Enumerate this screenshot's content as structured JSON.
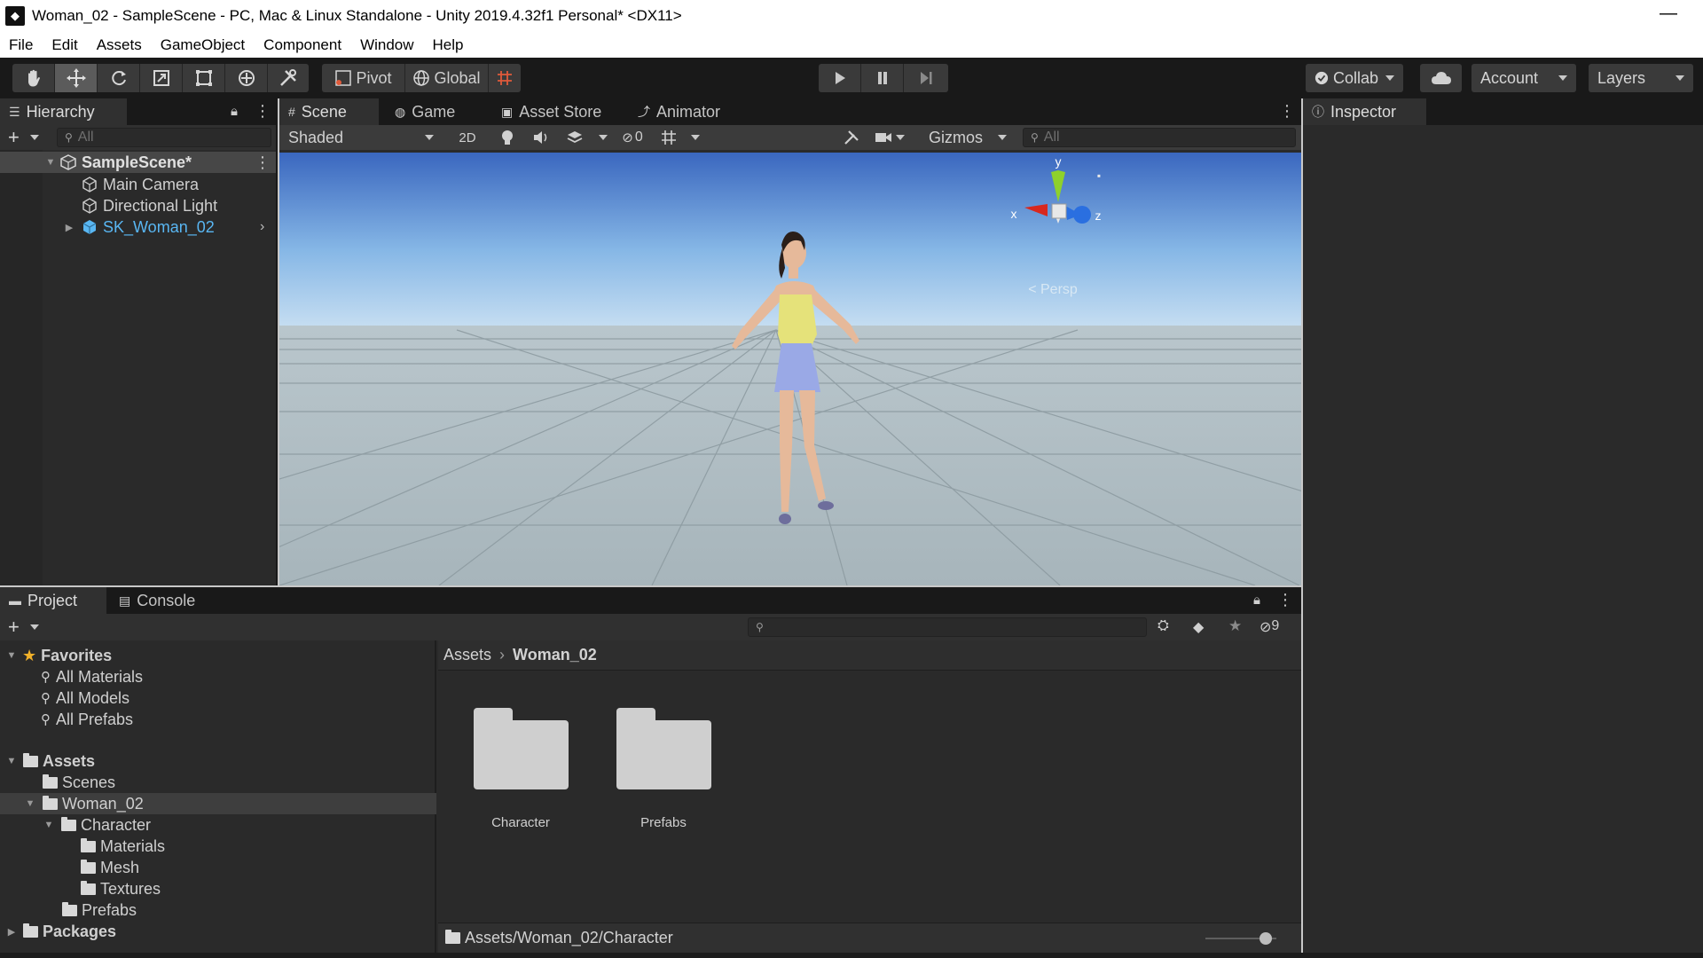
{
  "window": {
    "title": "Woman_02 - SampleScene - PC, Mac & Linux Standalone - Unity 2019.4.32f1 Personal* <DX11>",
    "minimize_glyph": "—"
  },
  "menu": [
    "File",
    "Edit",
    "Assets",
    "GameObject",
    "Component",
    "Window",
    "Help"
  ],
  "toolbar": {
    "pivot_label": "Pivot",
    "global_label": "Global",
    "collab_label": "Collab",
    "account_label": "Account",
    "layers_label": "Layers"
  },
  "hierarchy": {
    "tab_label": "Hierarchy",
    "search_placeholder": "All",
    "scene_name": "SampleScene*",
    "items": [
      "Main Camera",
      "Directional Light",
      "SK_Woman_02"
    ]
  },
  "scene_tabs": [
    "Scene",
    "Game",
    "Asset Store",
    "Animator"
  ],
  "scene_toolbar": {
    "shading_mode": "Shaded",
    "mode_2d": "2D",
    "hidden_count": "0",
    "gizmos_label": "Gizmos",
    "search_placeholder": "All"
  },
  "gizmo": {
    "y": "y",
    "x": "x",
    "z": "z",
    "persp_label": "< Persp"
  },
  "inspector": {
    "tab_label": "Inspector"
  },
  "project": {
    "tabs": [
      "Project",
      "Console"
    ],
    "hidden_count": "9",
    "breadcrumb": [
      "Assets",
      "Woman_02"
    ],
    "tree": {
      "favorites_label": "Favorites",
      "favorites": [
        "All Materials",
        "All Models",
        "All Prefabs"
      ],
      "assets_label": "Assets",
      "scenes": "Scenes",
      "woman": "Woman_02",
      "character": "Character",
      "materials": "Materials",
      "mesh": "Mesh",
      "textures": "Textures",
      "prefabs": "Prefabs",
      "packages_label": "Packages"
    },
    "grid_items": [
      "Character",
      "Prefabs"
    ],
    "status_path": "Assets/Woman_02/Character"
  },
  "colors": {
    "sky_top": "#3d6fc6",
    "sky_horizon": "#9cc8ea",
    "ground": "#a9b6bc",
    "selected_text": "#59b6f2",
    "gizmo_x": "#d8281e",
    "gizmo_y": "#8ed12c",
    "gizmo_z": "#2a6fe0",
    "play_icon": "#c8c8c8"
  }
}
